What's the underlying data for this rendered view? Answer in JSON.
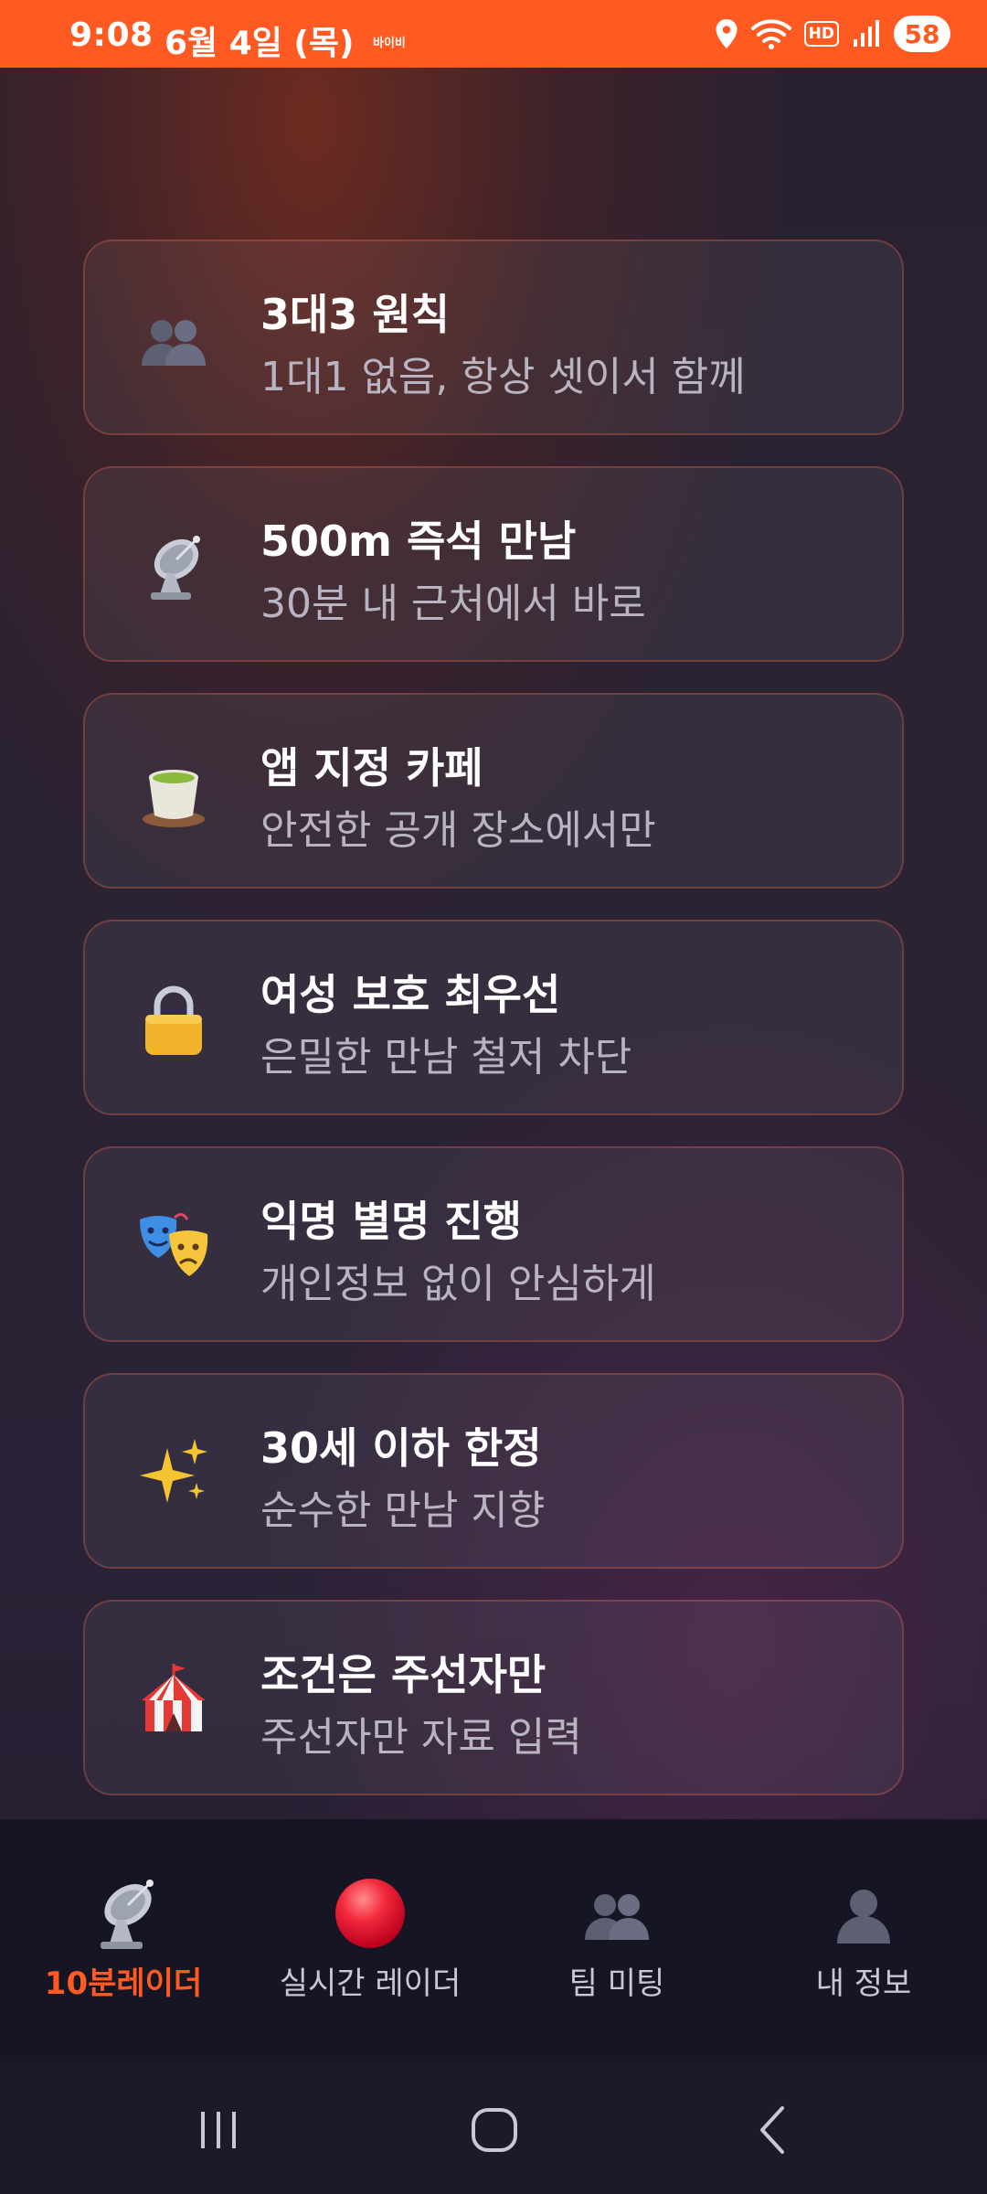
{
  "status_bar": {
    "time": "9:08",
    "date": "6월 4일 (목)",
    "carrier_tag": "바이비",
    "network_badge": "HD",
    "battery": "58",
    "color": "#ff5a22"
  },
  "features": [
    {
      "icon": "two-people-icon",
      "title": "3대3 원칙",
      "subtitle": "1대1 없음, 항상 셋이서 함께"
    },
    {
      "icon": "satellite-dish-icon",
      "title": "500m 즉석 만남",
      "subtitle": "30분 내 근처에서 바로"
    },
    {
      "icon": "tea-cup-icon",
      "title": "앱 지정 카페",
      "subtitle": "안전한 공개 장소에서만"
    },
    {
      "icon": "lock-icon",
      "title": "여성 보호 최우선",
      "subtitle": "은밀한 만남 철저 차단"
    },
    {
      "icon": "theater-masks-icon",
      "title": "익명 별명 진행",
      "subtitle": "개인정보 없이 안심하게"
    },
    {
      "icon": "sparkles-icon",
      "title": "30세 이하 한정",
      "subtitle": "순수한 만남 지향"
    },
    {
      "icon": "circus-tent-icon",
      "title": "조건은 주선자만",
      "subtitle": "주선자만 자료 입력"
    }
  ],
  "bottom_nav": {
    "active_color": "#ff5a22",
    "items": [
      {
        "icon": "satellite-dish-icon",
        "label": "10분레이더",
        "active": true
      },
      {
        "icon": "red-circle-icon",
        "label": "실시간 레이더",
        "active": false
      },
      {
        "icon": "two-people-icon",
        "label": "팀 미팅",
        "active": false
      },
      {
        "icon": "person-icon",
        "label": "내 정보",
        "active": false
      }
    ]
  },
  "system_nav": {
    "buttons": [
      "recents-icon",
      "home-icon",
      "back-icon"
    ]
  }
}
